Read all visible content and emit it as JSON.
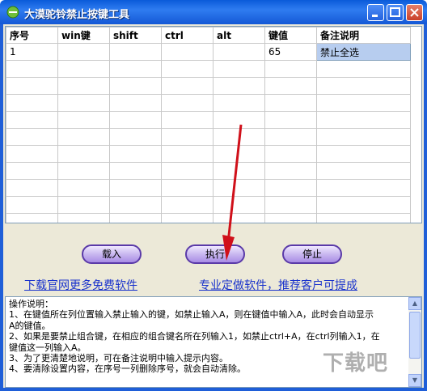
{
  "window": {
    "title": "大漠驼铃禁止按键工具"
  },
  "table": {
    "columns": [
      "序号",
      "win键",
      "shift",
      "ctrl",
      "alt",
      "键值",
      "备注说明"
    ],
    "rows": [
      [
        "1",
        "",
        "",
        "",
        "",
        "65",
        "禁止全选"
      ]
    ],
    "selected_cell": {
      "row": 0,
      "col": 6
    }
  },
  "buttons": {
    "load": "载入",
    "execute": "执行",
    "stop": "停止"
  },
  "links": {
    "download": "下载官网更多免费软件",
    "custom": "专业定做软件，推荐客户可提成"
  },
  "instructions": [
    "操作说明：",
    "1、在键值所在列位置输入禁止输入的键，如禁止输入A，则在键值中输入A，此时会自动显示",
    "A的键值。",
    "2、如果是要禁止组合键，在相应的组合键名所在列输入1，如禁止ctrl+A，在ctrl列输入1，在",
    "键值这一列输入A。",
    "3、为了更清楚地说明，可在备注说明中输入提示内容。",
    "4、要清除设置内容，在序号一列删除序号，就会自动清除。"
  ],
  "watermark": "下载吧",
  "colors": {
    "titlebar": "#1458d6",
    "button_border": "#5a3aa8",
    "link": "#1a33cc",
    "selection": "#b7cdef"
  }
}
